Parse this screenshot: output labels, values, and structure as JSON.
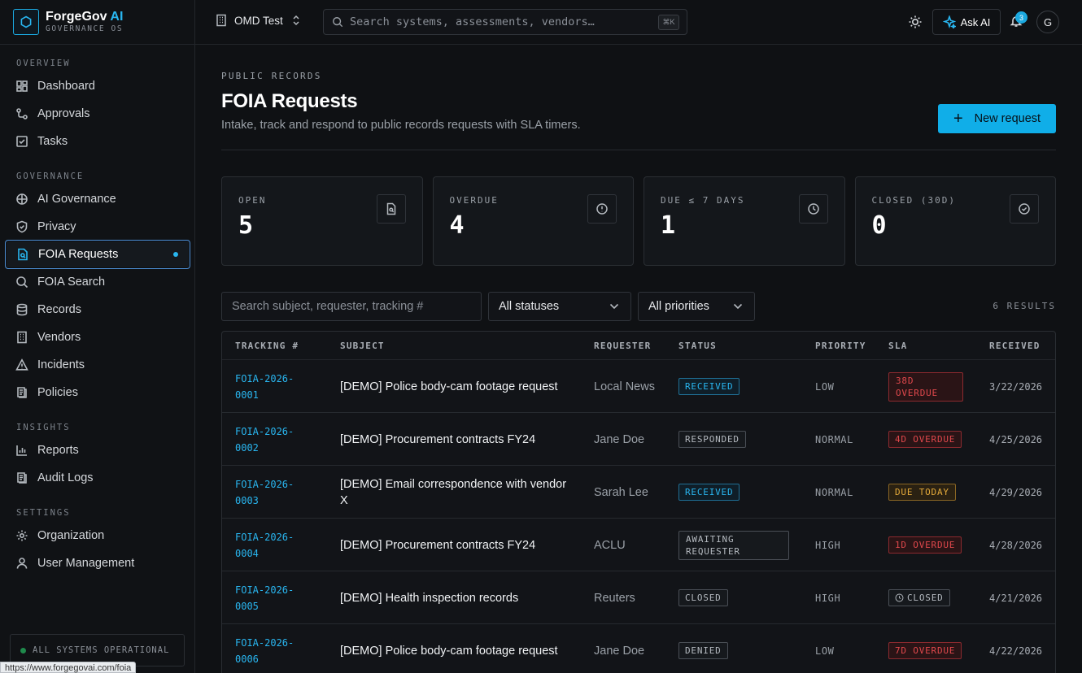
{
  "brand": {
    "name": "ForgeGov",
    "name_ai": "AI",
    "subtitle": "GOVERNANCE OS"
  },
  "sidebar": {
    "sections": [
      {
        "title": "OVERVIEW",
        "items": [
          {
            "label": "Dashboard",
            "icon": "dashboard-icon"
          },
          {
            "label": "Approvals",
            "icon": "approvals-icon"
          },
          {
            "label": "Tasks",
            "icon": "tasks-icon"
          }
        ]
      },
      {
        "title": "GOVERNANCE",
        "items": [
          {
            "label": "AI Governance",
            "icon": "ai-governance-icon"
          },
          {
            "label": "Privacy",
            "icon": "shield-icon"
          },
          {
            "label": "FOIA Requests",
            "icon": "document-search-icon",
            "active": true
          },
          {
            "label": "FOIA Search",
            "icon": "search-icon"
          },
          {
            "label": "Records",
            "icon": "database-icon"
          },
          {
            "label": "Vendors",
            "icon": "building-icon"
          },
          {
            "label": "Incidents",
            "icon": "warning-icon"
          },
          {
            "label": "Policies",
            "icon": "policy-icon"
          }
        ]
      },
      {
        "title": "INSIGHTS",
        "items": [
          {
            "label": "Reports",
            "icon": "bar-chart-icon"
          },
          {
            "label": "Audit Logs",
            "icon": "audit-log-icon"
          }
        ]
      },
      {
        "title": "SETTINGS",
        "items": [
          {
            "label": "Organization",
            "icon": "gear-icon"
          },
          {
            "label": "User Management",
            "icon": "user-icon"
          }
        ]
      }
    ],
    "status": "ALL SYSTEMS OPERATIONAL",
    "url_tooltip": "https://www.forgegovai.com/foia"
  },
  "topbar": {
    "workspace": "OMD Test",
    "search_placeholder": "Search systems, assessments, vendors…",
    "shortcut": "⌘K",
    "ask_ai": "Ask AI",
    "notifications": "3",
    "avatar": "G"
  },
  "page": {
    "eyebrow": "PUBLIC RECORDS",
    "title": "FOIA Requests",
    "subtitle": "Intake, track and respond to public records requests with SLA timers.",
    "new_button": "New request"
  },
  "stats": [
    {
      "label": "OPEN",
      "value": "5",
      "icon": "document-search-icon"
    },
    {
      "label": "OVERDUE",
      "value": "4",
      "icon": "alert-circle-icon"
    },
    {
      "label": "DUE ≤ 7 DAYS",
      "value": "1",
      "icon": "clock-icon"
    },
    {
      "label": "CLOSED (30D)",
      "value": "0",
      "icon": "check-circle-icon"
    }
  ],
  "filters": {
    "search_placeholder": "Search subject, requester, tracking #",
    "status": "All statuses",
    "priority": "All priorities",
    "results": "6 RESULTS"
  },
  "table": {
    "headers": [
      "TRACKING #",
      "SUBJECT",
      "REQUESTER",
      "STATUS",
      "PRIORITY",
      "SLA",
      "RECEIVED"
    ],
    "rows": [
      {
        "tracking": "FOIA-2026-0001",
        "subject": "[DEMO] Police body-cam footage request",
        "requester": "Local News",
        "status": "RECEIVED",
        "status_kind": "received",
        "priority": "LOW",
        "sla": "38D OVERDUE",
        "sla_kind": "overdue",
        "received": "3/22/2026"
      },
      {
        "tracking": "FOIA-2026-0002",
        "subject": "[DEMO] Procurement contracts FY24",
        "requester": "Jane Doe",
        "status": "RESPONDED",
        "status_kind": "neutral",
        "priority": "NORMAL",
        "sla": "4D OVERDUE",
        "sla_kind": "overdue",
        "received": "4/25/2026"
      },
      {
        "tracking": "FOIA-2026-0003",
        "subject": "[DEMO] Email correspondence with vendor X",
        "requester": "Sarah Lee",
        "status": "RECEIVED",
        "status_kind": "received",
        "priority": "NORMAL",
        "sla": "DUE TODAY",
        "sla_kind": "due",
        "received": "4/29/2026"
      },
      {
        "tracking": "FOIA-2026-0004",
        "subject": "[DEMO] Procurement contracts FY24",
        "requester": "ACLU",
        "status": "AWAITING REQUESTER",
        "status_kind": "neutral",
        "priority": "HIGH",
        "sla": "1D OVERDUE",
        "sla_kind": "overdue",
        "received": "4/28/2026"
      },
      {
        "tracking": "FOIA-2026-0005",
        "subject": "[DEMO] Health inspection records",
        "requester": "Reuters",
        "status": "CLOSED",
        "status_kind": "neutral",
        "priority": "HIGH",
        "sla": "CLOSED",
        "sla_kind": "closed",
        "received": "4/21/2026"
      },
      {
        "tracking": "FOIA-2026-0006",
        "subject": "[DEMO] Police body-cam footage request",
        "requester": "Jane Doe",
        "status": "DENIED",
        "status_kind": "neutral",
        "priority": "LOW",
        "sla": "7D OVERDUE",
        "sla_kind": "overdue",
        "received": "4/22/2026"
      }
    ]
  }
}
